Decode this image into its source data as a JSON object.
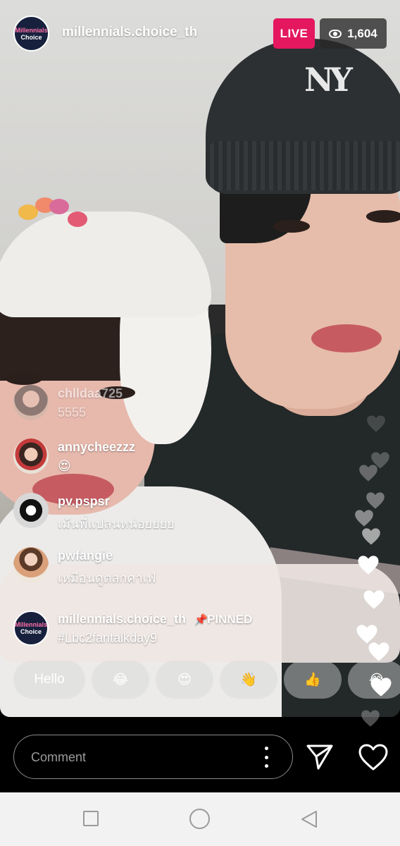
{
  "host": {
    "avatar_line1": "Millennials",
    "avatar_line2": "Choice",
    "username": "millennials.choice_th"
  },
  "live_badge": "LIVE",
  "viewer_count": "1,604",
  "comments": [
    {
      "username": "chlldaa725",
      "text": "5555"
    },
    {
      "username": "annycheezzz",
      "text": "😍"
    },
    {
      "username": "pv.pspsr",
      "text": "เม้นพี่แปลนหน่อยยยย"
    },
    {
      "username": "pwfangie",
      "text": "เหมือนดูตลกคาเฟ่"
    }
  ],
  "pinned_comment": {
    "avatar_line1": "Millennials",
    "avatar_line2": "Choice",
    "username": "millennials.choice_th",
    "pin_icon": "📌",
    "pinned_label": "PINNED",
    "text": "#Lbc2fantalkday9"
  },
  "quick_reactions": [
    "Hello",
    "😂",
    "😍",
    "👋",
    "👍",
    "😂"
  ],
  "comment_input": {
    "placeholder": "Comment"
  },
  "icons": {
    "viewers": "eye-icon",
    "options": "more-vertical-icon",
    "send": "paper-plane-icon",
    "like": "heart-icon",
    "floating": "heart-icon",
    "nav_recent": "square-icon",
    "nav_home": "circle-icon",
    "nav_back": "triangle-back-icon"
  },
  "colors": {
    "live_badge": "#e4175f",
    "viewer_badge": "#282828",
    "background": "#000000",
    "navbar": "#f2f2f2"
  }
}
